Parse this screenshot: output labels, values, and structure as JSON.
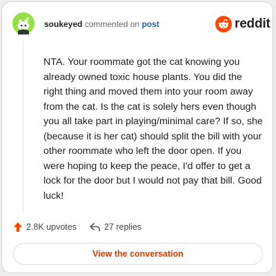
{
  "comment": {
    "username": "soukeyed",
    "action_text": "commented on",
    "target_link": "post",
    "body": "NTA. Your roommate got the cat knowing you already owned toxic house plants. You did the right thing and moved them into your room away from the cat. Is the cat is solely hers even though you all take part in playing/minimal care? If so, she (because it is her cat) should split the bill with your other roommate who left the door open. If you were hoping to keep the peace, I'd offer to get a lock for the door but I would not pay that bill. Good luck!"
  },
  "brand": {
    "name": "reddit",
    "color": "#ff4500"
  },
  "actions": {
    "upvotes": "2.8K upvotes",
    "replies": "27 replies"
  },
  "cta": {
    "label": "View the conversation"
  },
  "colors": {
    "avatar_bg": "#94e044",
    "accent_link": "#1a5fb4",
    "cta_text": "#d93a00",
    "upvote_icon": "#ff4500"
  },
  "icons": {
    "avatar": "snoo-avatar-icon",
    "logo": "reddit-logo-icon",
    "upvote": "upvote-arrow-icon",
    "reply": "reply-arrow-icon"
  }
}
